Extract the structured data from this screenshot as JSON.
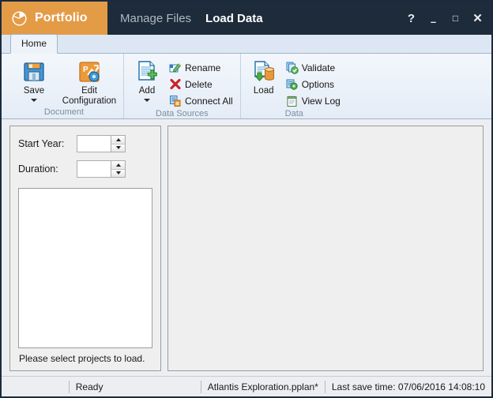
{
  "titlebar": {
    "brand": "Portfolio",
    "brand_icon": "pie-chart-icon",
    "menu": [
      {
        "label": "Manage Files",
        "active": false
      },
      {
        "label": "Load Data",
        "active": true
      }
    ],
    "controls": {
      "help": "?",
      "minimize": "–",
      "maximize": "□",
      "close": "✕"
    }
  },
  "ribbon": {
    "tabs": [
      {
        "label": "Home",
        "selected": true
      }
    ],
    "groups": [
      {
        "title": "Document",
        "big_buttons": [
          {
            "label": "Save",
            "icon": "floppy-disk-icon",
            "has_dropdown": true
          },
          {
            "label": "Edit\nConfiguration",
            "label_line1": "Edit",
            "label_line2": "Configuration",
            "icon": "edit-configuration-icon",
            "has_dropdown": false
          }
        ],
        "small_buttons": []
      },
      {
        "title": "Data Sources",
        "big_buttons": [
          {
            "label": "Add",
            "icon": "add-document-icon",
            "has_dropdown": true
          }
        ],
        "small_buttons": [
          {
            "label": "Rename",
            "icon": "rename-icon"
          },
          {
            "label": "Delete",
            "icon": "delete-x-icon"
          },
          {
            "label": "Connect All",
            "icon": "connect-all-icon"
          }
        ]
      },
      {
        "title": "Data",
        "big_buttons": [
          {
            "label": "Load",
            "icon": "load-database-icon",
            "has_dropdown": false
          }
        ],
        "small_buttons": [
          {
            "label": "Validate",
            "icon": "validate-check-icon"
          },
          {
            "label": "Options",
            "icon": "options-gear-icon"
          },
          {
            "label": "View Log",
            "icon": "view-log-icon"
          }
        ]
      }
    ]
  },
  "left_panel": {
    "fields": [
      {
        "label": "Start Year:",
        "value": "",
        "placeholder": ""
      },
      {
        "label": "Duration:",
        "value": "",
        "placeholder": ""
      }
    ],
    "project_list": {
      "items": []
    },
    "hint": "Please select projects to load."
  },
  "right_panel": {
    "content": ""
  },
  "statusbar": {
    "ready": "Ready",
    "file": "Atlantis Exploration.pplan*",
    "last_save": "Last save time: 07/06/2016 14:08:10"
  },
  "colors": {
    "brand_orange": "#e49b46",
    "titlebar_dark": "#1d2b3a",
    "ribbon_blue": "#e7eef7",
    "panel_grey": "#efefef"
  }
}
